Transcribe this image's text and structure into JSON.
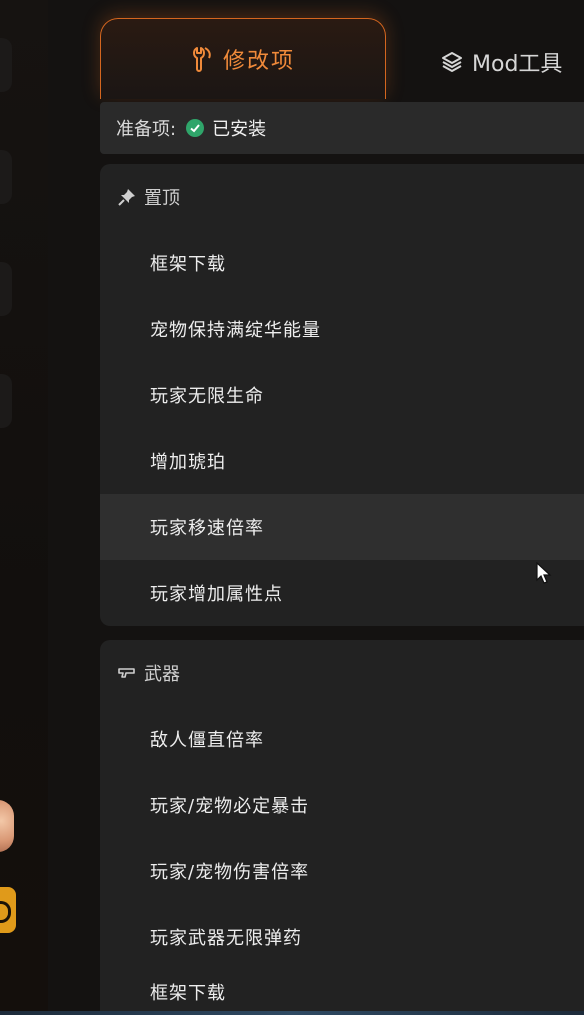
{
  "tabs": {
    "active_label": "修改项",
    "second_label": "Mod工具"
  },
  "prepare": {
    "label": "准备项:",
    "status": "已安装"
  },
  "sections": [
    {
      "icon": "pin-icon",
      "title": "置顶",
      "items": [
        "框架下载",
        "宠物保持满绽华能量",
        "玩家无限生命",
        "增加琥珀",
        "玩家移速倍率",
        "玩家增加属性点"
      ]
    },
    {
      "icon": "gun-icon",
      "title": "武器",
      "items": [
        "敌人僵直倍率",
        "玩家/宠物必定暴击",
        "玩家/宠物伤害倍率",
        "玩家武器无限弹药",
        "框架下载"
      ]
    }
  ],
  "colors": {
    "accent": "#f08a3a",
    "success": "#2fa56a",
    "panel": "#222222",
    "hover": "#2f2f2f"
  }
}
